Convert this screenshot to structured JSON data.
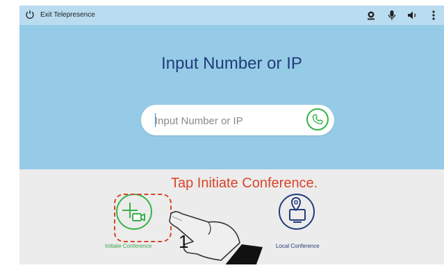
{
  "topbar": {
    "exit_label": "Exit Telepresence",
    "icons": [
      "camera-icon",
      "microphone-icon",
      "speaker-icon",
      "more-icon"
    ]
  },
  "hero": {
    "title": "Input Number or IP",
    "search_placeholder": "Input Number or IP",
    "search_value": ""
  },
  "actions": {
    "initiate_label": "Initiate Conference",
    "local_label": "Local Conference"
  },
  "annotation": {
    "instruction": "Tap Initiate Conference.",
    "step_number": "1"
  },
  "colors": {
    "topbar": "#b9dcf0",
    "hero": "#96cbe7",
    "accent_green": "#36b247",
    "accent_navy": "#233b7a",
    "annotation_red": "#d9442a"
  }
}
